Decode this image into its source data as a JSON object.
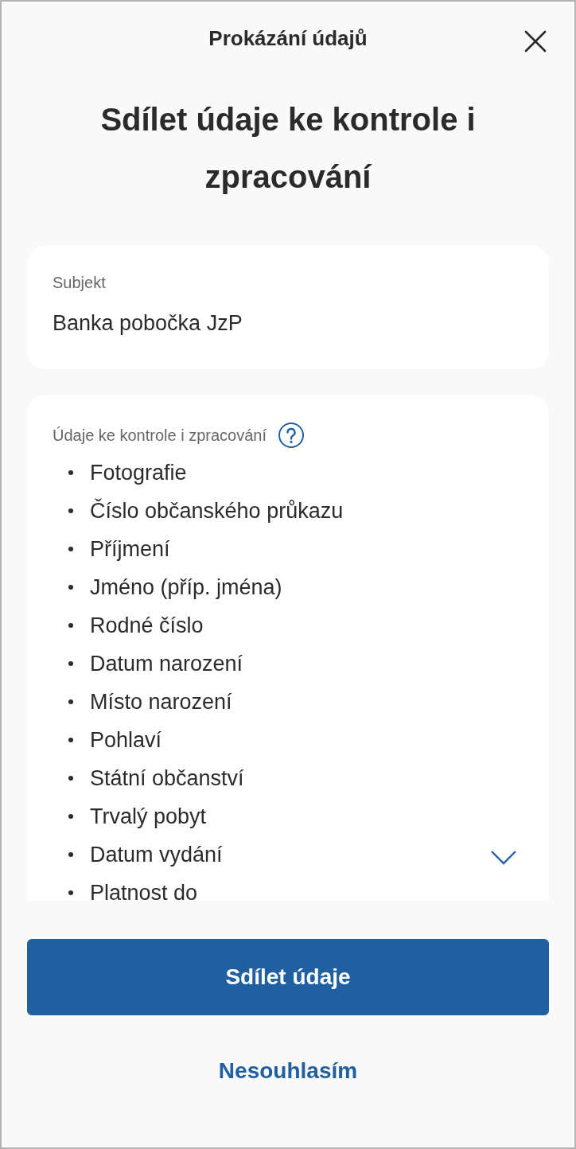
{
  "header": {
    "title": "Prokázání údajů"
  },
  "heading": "Sdílet údaje ke kontrole i zpracování",
  "subject": {
    "label": "Subjekt",
    "value": "Banka pobočka JzP"
  },
  "data_card": {
    "label": "Údaje ke kontrole i zpracování",
    "items": [
      "Fotografie",
      "Číslo občanského průkazu",
      "Příjmení",
      "Jméno (příp. jména)",
      "Rodné číslo",
      "Datum narození",
      "Místo narození",
      "Pohlaví",
      "Státní občanství",
      "Trvalý pobyt",
      "Datum vydání",
      "Platnost do"
    ]
  },
  "primary_button": "Sdílet údaje",
  "secondary_button": "Nesouhlasím"
}
